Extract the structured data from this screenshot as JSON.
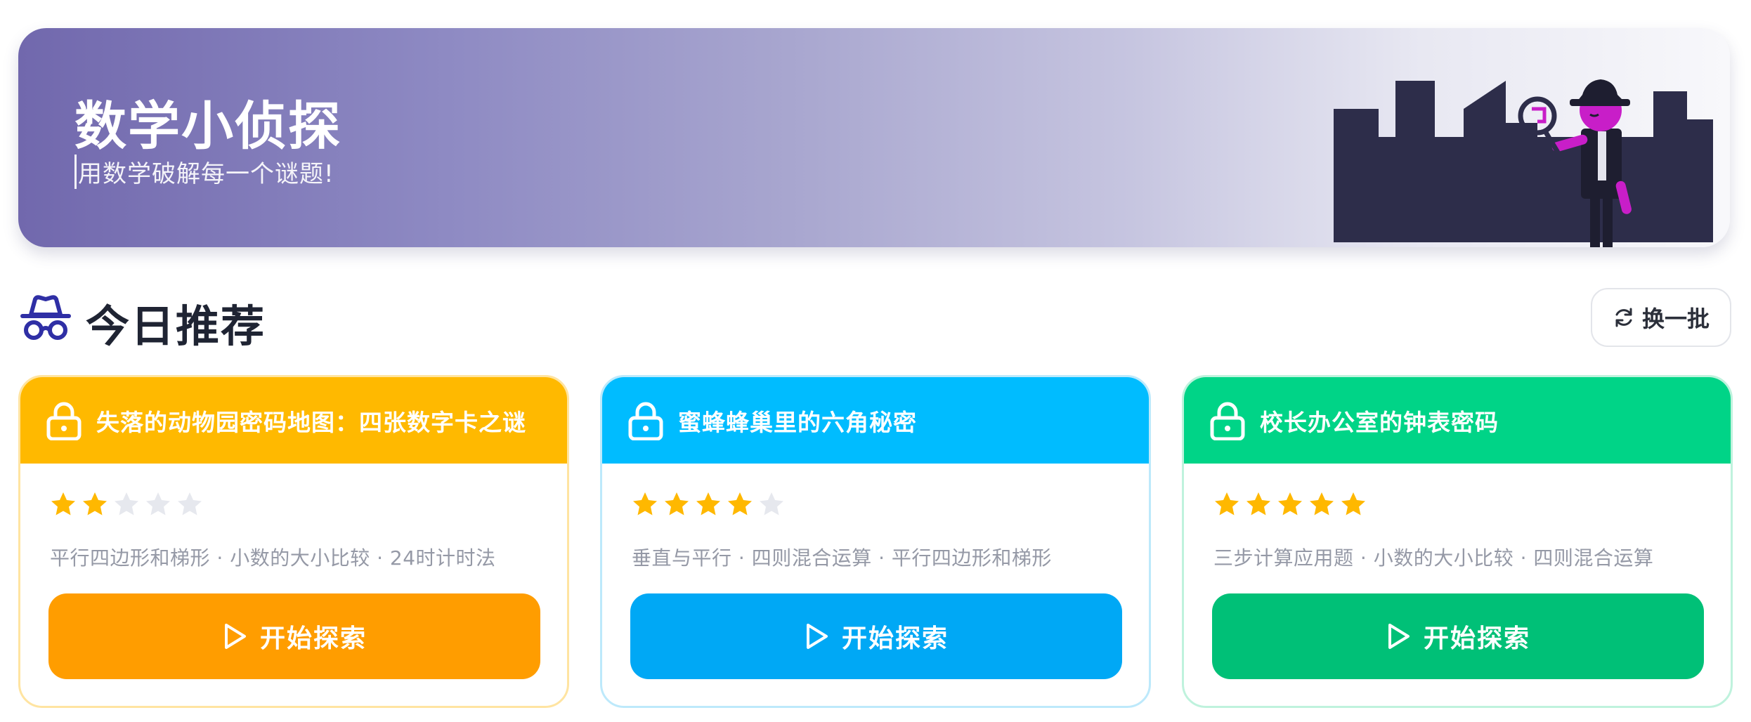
{
  "banner": {
    "title": "数学小侦探",
    "subtitle": "用数学破解每一个谜题!"
  },
  "section": {
    "title": "今日推荐",
    "icon": "detective-icon",
    "refresh_label": "换一批"
  },
  "cards": [
    {
      "title": "失落的动物园密码地图：四张数字卡之谜",
      "rating": 2,
      "max_rating": 5,
      "topics": "平行四边形和梯形 · 小数的大小比较 · 24时计时法",
      "button_label": "开始探索",
      "header_color": "#ffb900",
      "button_color": "#ff9d00",
      "border_color": "#ffe4a1"
    },
    {
      "title": "蜜蜂蜂巢里的六角秘密",
      "rating": 4,
      "max_rating": 5,
      "topics": "垂直与平行 · 四则混合运算 · 平行四边形和梯形",
      "button_label": "开始探索",
      "header_color": "#00bcff",
      "button_color": "#00a8f5",
      "border_color": "#bde9fb"
    },
    {
      "title": "校长办公室的钟表密码",
      "rating": 5,
      "max_rating": 5,
      "topics": "三步计算应用题 · 小数的大小比较 · 四则混合运算",
      "button_label": "开始探索",
      "header_color": "#00d487",
      "button_color": "#00c077",
      "border_color": "#bff2dd"
    }
  ],
  "colors": {
    "star_filled": "#ffb800",
    "star_empty": "#e6e8ee",
    "brand": "#7168ad"
  }
}
